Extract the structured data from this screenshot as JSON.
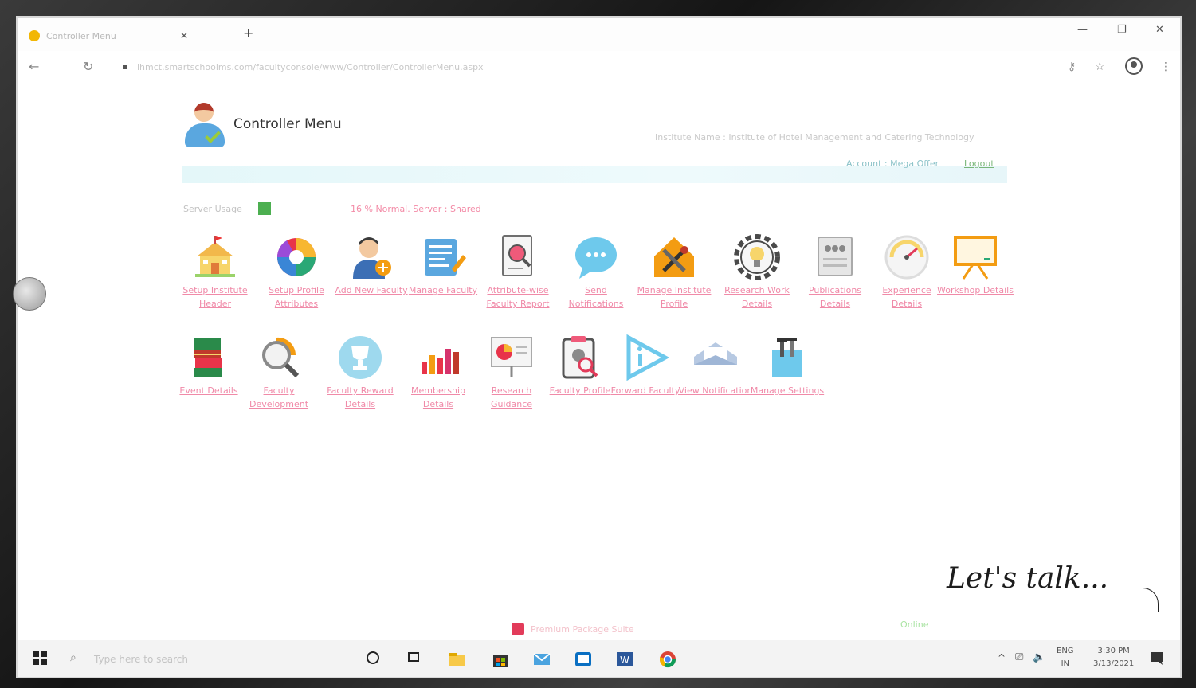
{
  "browser": {
    "tab_title": "Controller Menu",
    "url": "ihmct.smartschoolms.com/facultyconsole/www/Controller/ControllerMenu.aspx"
  },
  "header": {
    "title": "Controller Menu",
    "institute": "Institute Name : Institute of Hotel Management and Catering Technology",
    "account": "Account : Mega Offer",
    "logout": "Logout"
  },
  "server": {
    "label": "Server Usage",
    "status": "16 % Normal. Server : Shared",
    "color": "#4caf50"
  },
  "row1": [
    {
      "label": "Setup Institute Header",
      "icon": "school-building-icon"
    },
    {
      "label": "Setup Profile Attributes",
      "icon": "colorful-gear-icon"
    },
    {
      "label": "Add New Faculty",
      "icon": "add-user-icon"
    },
    {
      "label": "Manage Faculty",
      "icon": "document-edit-icon"
    },
    {
      "label": "Attribute-wise Faculty Report",
      "icon": "report-search-icon"
    },
    {
      "label": "Send Notifications",
      "icon": "chat-bubble-icon"
    },
    {
      "label": "Manage Institute Profile",
      "icon": "tools-house-icon"
    },
    {
      "label": "Research Work Details",
      "icon": "lightbulb-gear-icon"
    },
    {
      "label": "Publications Details",
      "icon": "publications-icon"
    },
    {
      "label": "Experience Details",
      "icon": "gauge-icon"
    },
    {
      "label": "Workshop Details",
      "icon": "presentation-board-icon"
    }
  ],
  "row2": [
    {
      "label": "Event Details",
      "icon": "books-icon"
    },
    {
      "label": "Faculty Development",
      "icon": "magnifier-chart-icon"
    },
    {
      "label": "Faculty Reward Details",
      "icon": "trophy-icon"
    },
    {
      "label": "Membership Details",
      "icon": "bar-chart-icon"
    },
    {
      "label": "Research Guidance",
      "icon": "pie-chart-board-icon"
    },
    {
      "label": "Faculty Profile",
      "icon": "profile-clipboard-icon"
    },
    {
      "label": "Forward Faculty",
      "icon": "forward-arrow-icon"
    },
    {
      "label": "View Notification",
      "icon": "envelope-icon"
    },
    {
      "label": "Manage Settings",
      "icon": "toolbox-icon"
    }
  ],
  "promo": "Premium Package Suite",
  "chat": {
    "online": "Online",
    "lets_talk": "Let's talk..."
  },
  "taskbar": {
    "search_placeholder": "Type here to search",
    "lang": "ENG",
    "region": "IN",
    "time": "3:30 PM",
    "date": "3/13/2021"
  }
}
